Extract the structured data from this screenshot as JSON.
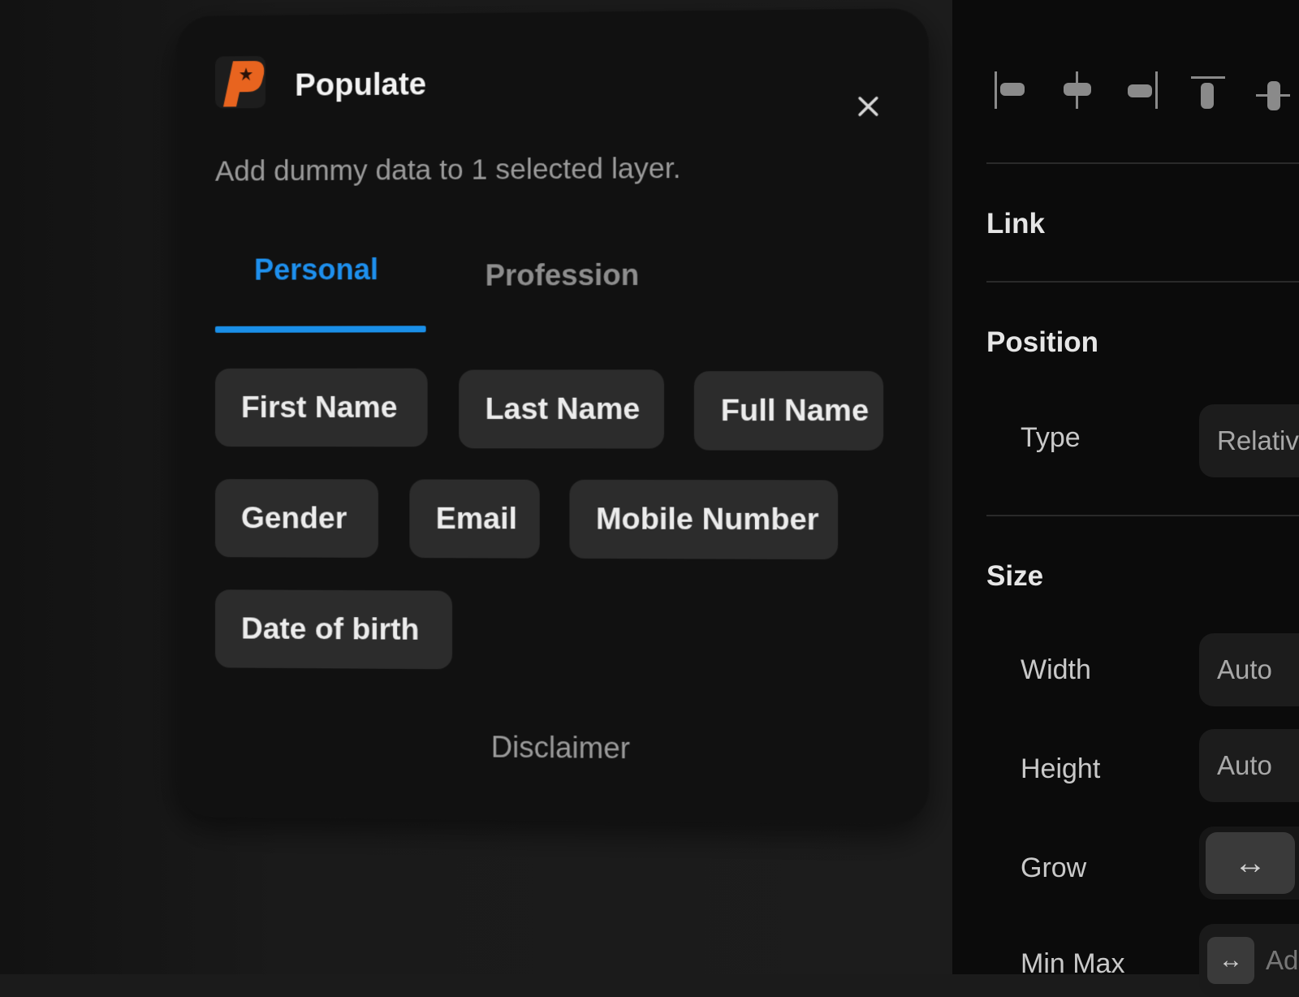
{
  "modal": {
    "title": "Populate",
    "subtitle": "Add dummy data to 1 selected layer.",
    "close_icon": "×",
    "tabs": [
      {
        "label": "Personal",
        "active": true
      },
      {
        "label": "Profession",
        "active": false
      }
    ],
    "chips": [
      "First Name",
      "Last Name",
      "Full Name",
      "Gender",
      "Email",
      "Mobile Number",
      "Date of birth"
    ],
    "disclaimer": "Disclaimer",
    "accent_color": "#1a8fe8",
    "logo_color": "#e8641f"
  },
  "panel": {
    "alignment_icons": [
      "align-left-icon",
      "align-horizontal-center-icon",
      "align-right-icon",
      "align-top-icon",
      "align-vertical-center-icon"
    ],
    "sections": {
      "link": "Link",
      "position": "Position",
      "size": "Size"
    },
    "type_label": "Type",
    "type_value": "Relativ",
    "width_label": "Width",
    "width_value": "Auto",
    "height_label": "Height",
    "height_value": "Auto",
    "grow_label": "Grow",
    "grow_icon": "↔",
    "minmax_label": "Min Max",
    "minmax_icon": "↔",
    "minmax_value": "Ad"
  }
}
